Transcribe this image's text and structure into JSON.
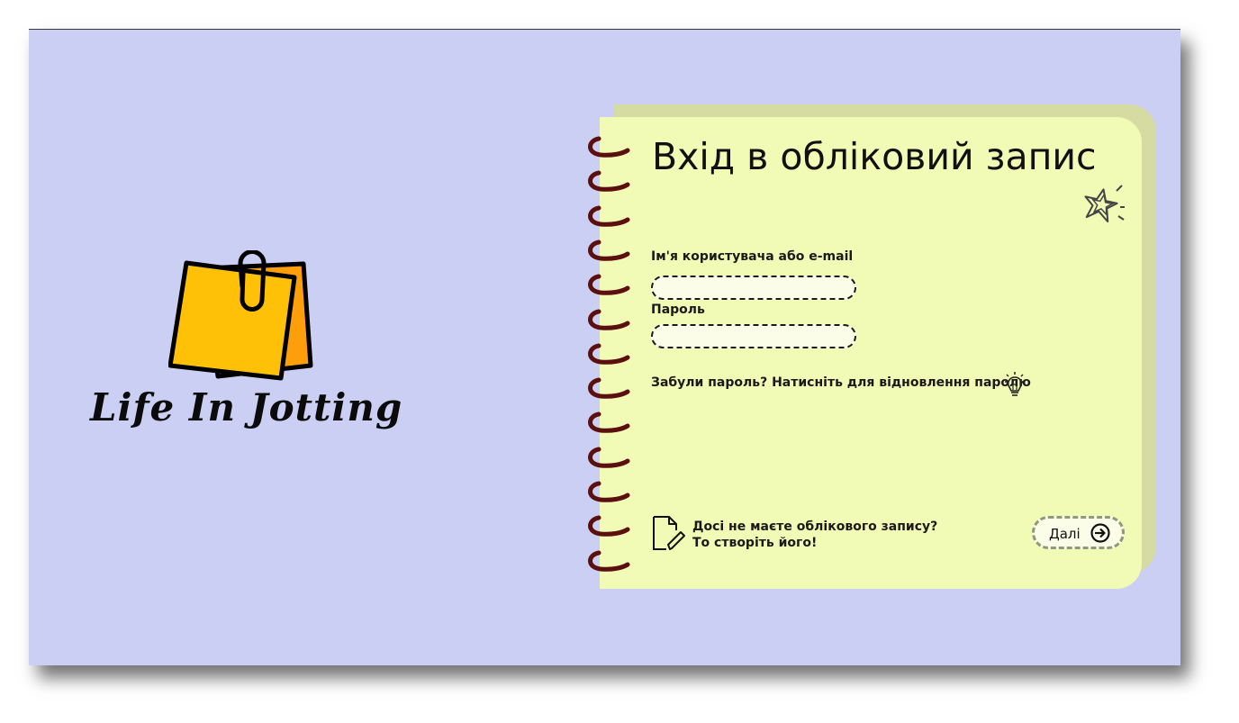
{
  "brand": {
    "name": "Life In Jotting",
    "logo_icon": "sticky-notes-with-paperclip",
    "logo_colors": {
      "front_note": "#ffc107",
      "back_note": "#ff9e0b",
      "outline": "#000000"
    }
  },
  "login": {
    "title": "Вхід в обліковий запис",
    "username_label": "Ім'я користувача або e-mail",
    "username_value": "",
    "password_label": "Пароль",
    "password_value": "",
    "forgot_text": "Забули пароль? Натисніть для відновлення паролю",
    "signup_line1": "Досі не маєте облікового запису?",
    "signup_line2": "То створіть його!",
    "next_label": "Далі"
  },
  "icons": {
    "decor": "star-icon",
    "forgot": "lightbulb-icon",
    "signup": "document-edit-icon",
    "next": "arrow-right-circle-icon"
  },
  "colors": {
    "background": "#cbcff3",
    "notebook": "#f1fbb5",
    "notebook_back": "#d6dca1",
    "rings": "#5b0f0f",
    "text": "#111111",
    "button_border": "#8e9a78"
  }
}
